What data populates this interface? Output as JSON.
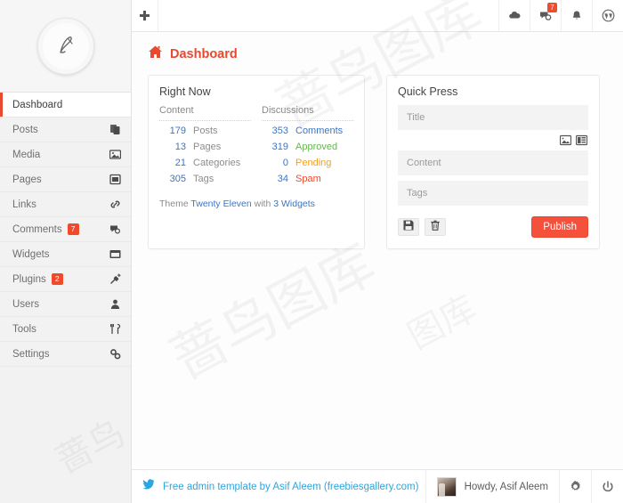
{
  "colors": {
    "accent_red": "#e8492f",
    "publish_red": "#f4503c",
    "link_blue": "#3a76c8",
    "footer_blue": "#2ba6e0",
    "green": "#63b84e",
    "orange": "#f0a02c",
    "badge_red": "#ef4a2c",
    "sidebar_bg": "#f2f2f2",
    "panel_bg": "#ffffff",
    "field_bg": "#f3f3f3"
  },
  "sidebar": {
    "logo_name": "logo-monogram",
    "items": [
      {
        "label": "Dashboard",
        "icon": "gauge-icon",
        "active": true,
        "badge": ""
      },
      {
        "label": "Posts",
        "icon": "posts-icon",
        "active": false,
        "badge": ""
      },
      {
        "label": "Media",
        "icon": "image-icon",
        "active": false,
        "badge": ""
      },
      {
        "label": "Pages",
        "icon": "page-icon",
        "active": false,
        "badge": ""
      },
      {
        "label": "Links",
        "icon": "link-icon",
        "active": false,
        "badge": ""
      },
      {
        "label": "Comments",
        "icon": "comment-icon",
        "active": false,
        "badge": "7"
      },
      {
        "label": "Widgets",
        "icon": "widget-icon",
        "active": false,
        "badge": ""
      },
      {
        "label": "Plugins",
        "icon": "plug-icon",
        "active": false,
        "badge": "2"
      },
      {
        "label": "Users",
        "icon": "user-icon",
        "active": false,
        "badge": ""
      },
      {
        "label": "Tools",
        "icon": "tools-icon",
        "active": false,
        "badge": ""
      },
      {
        "label": "Settings",
        "icon": "gears-icon",
        "active": false,
        "badge": ""
      }
    ]
  },
  "topbar": {
    "add_new_icon": "plus-icon",
    "items": [
      {
        "icon": "cloud-icon",
        "badge": ""
      },
      {
        "icon": "comments-icon",
        "badge": "7"
      },
      {
        "icon": "bell-icon",
        "badge": ""
      },
      {
        "icon": "wordpress-icon",
        "badge": ""
      }
    ]
  },
  "page": {
    "icon": "home-icon",
    "title": "Dashboard"
  },
  "right_now": {
    "title": "Right Now",
    "content_header": "Content",
    "discussions_header": "Discussions",
    "content_rows": [
      {
        "count": "179",
        "label": "Posts"
      },
      {
        "count": "13",
        "label": "Pages"
      },
      {
        "count": "21",
        "label": "Categories"
      },
      {
        "count": "305",
        "label": "Tags"
      }
    ],
    "discussion_rows": [
      {
        "count": "353",
        "label": "Comments",
        "tone": "link"
      },
      {
        "count": "319",
        "label": "Approved",
        "tone": "green"
      },
      {
        "count": "0",
        "label": "Pending",
        "tone": "orange"
      },
      {
        "count": "34",
        "label": "Spam",
        "tone": "red"
      }
    ],
    "theme_prefix": "Theme ",
    "theme_name": "Twenty Eleven",
    "theme_middle": " with ",
    "theme_widgets": "3 Widgets"
  },
  "quick_press": {
    "title": "Quick Press",
    "title_placeholder": "Title",
    "content_placeholder": "Content",
    "tags_placeholder": "Tags",
    "title_value": "",
    "content_value": "",
    "tags_value": "",
    "media_buttons": [
      {
        "icon": "add-image-icon"
      },
      {
        "icon": "add-media-icon"
      }
    ],
    "save_icon": "save-icon",
    "trash_icon": "trash-icon",
    "publish_label": "Publish"
  },
  "footer": {
    "twitter_icon": "twitter-icon",
    "credit": "Free admin template by Asif Aleem (freebiesgallery.com)",
    "avatar": "user-avatar",
    "howdy": "Howdy, Asif Aleem",
    "settings_icon": "gear-icon",
    "power_icon": "power-icon"
  },
  "watermark": {
    "line1": "蔷鸟图库",
    "line2": "蔷鸟图库",
    "line3": "图库",
    "line4": "蔷鸟"
  }
}
